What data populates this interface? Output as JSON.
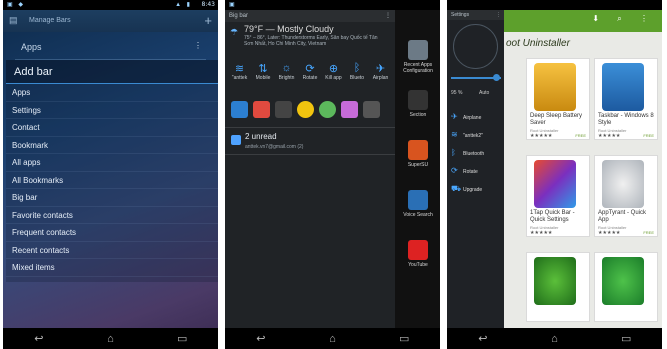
{
  "phone1": {
    "status_time": "8:43",
    "header_title": "Manage Bars",
    "apps_heading": "Apps",
    "menu_title": "Add bar",
    "menu_items": [
      "Apps",
      "Settings",
      "Contact",
      "Bookmark",
      "All apps",
      "All Bookmarks",
      "Big bar",
      "Favorite contacts",
      "Frequent contacts",
      "Recent contacts",
      "Mixed items"
    ]
  },
  "phone2": {
    "header_title": "Big bar",
    "weather_temp": "79°F — Mostly Cloudy",
    "weather_desc": "75° – 86°, Later: Thunderstorms Early, Sân bay Quốc tế Tân Sơn Nhất, Ho Chi Minh City, Vietnam",
    "toggles": [
      "\"anttek",
      "Mobile",
      "Brightn",
      "Rotate",
      "Kill app",
      "Blueto",
      "Airplan"
    ],
    "notif_title": "2 unread",
    "notif_sub": "anttek.vn7@gmail.com (2)",
    "side_apps": [
      "Recent Apps Configuration",
      "Section",
      "SuperSU",
      "Voice Search",
      "YouTube"
    ]
  },
  "phone3": {
    "header_title": "Settings",
    "brightness_pct": "95 %",
    "auto_label": "Auto",
    "panel_items": [
      "Airplane",
      "\"anttek2\"",
      "Bluetooth",
      "Rotate",
      "Upgrade"
    ],
    "store_title": "oot Uninstaller",
    "cards": [
      {
        "name": "Deep Sleep Battery Saver",
        "dev": "Root Uninstaller",
        "stars": "★★★★★",
        "price": "FREE"
      },
      {
        "name": "Taskbar - Windows 8 Style",
        "dev": "Root Uninstaller",
        "stars": "★★★★★",
        "price": "FREE"
      },
      {
        "name": "1Tap Quick Bar - Quick Settings",
        "dev": "Root Uninstaller",
        "stars": "★★★★★",
        "price": ""
      },
      {
        "name": "AppTyrant - Quick App",
        "dev": "Root Uninstaller",
        "stars": "★★★★★",
        "price": "FREE"
      }
    ]
  },
  "colors": {
    "accent": "#3a8ad1",
    "store_green": "#5da02c"
  }
}
